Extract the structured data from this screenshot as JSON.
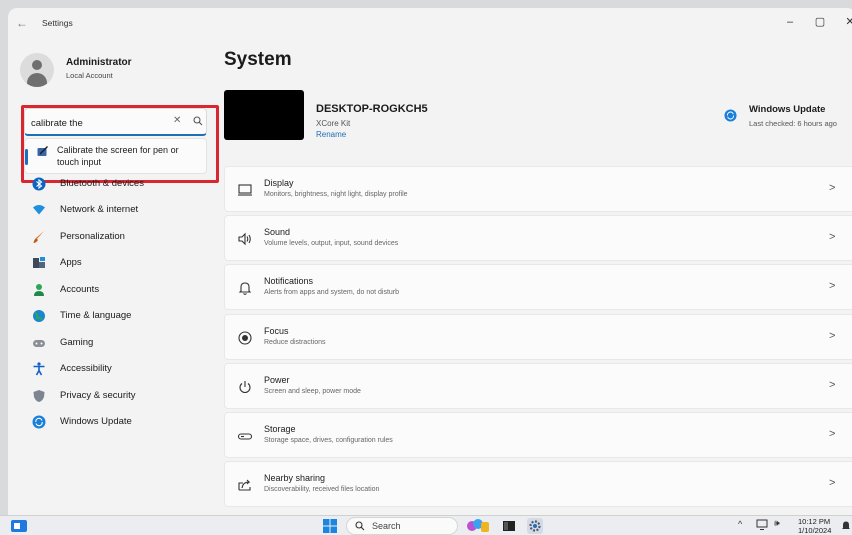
{
  "window": {
    "title": "Settings",
    "back_icon": "back-arrow-icon",
    "controls": {
      "minimize": "–",
      "maximize": "▢",
      "close": "✕"
    }
  },
  "user": {
    "name": "Administrator",
    "account_type": "Local Account"
  },
  "search": {
    "value": "calibrate the",
    "clear_icon": "✕",
    "suggestion": "Calibrate the screen for pen or touch input"
  },
  "sidebar": {
    "items": [
      {
        "label": "Bluetooth & devices",
        "icon": "bluetooth-icon",
        "color": "#0a65c2"
      },
      {
        "label": "Network & internet",
        "icon": "wifi-icon",
        "color": "#1f8fe0"
      },
      {
        "label": "Personalization",
        "icon": "brush-icon",
        "color": "#e07a22"
      },
      {
        "label": "Apps",
        "icon": "apps-icon",
        "color": "#3d4a5c"
      },
      {
        "label": "Accounts",
        "icon": "person-icon",
        "color": "#2aa75a"
      },
      {
        "label": "Time & language",
        "icon": "globe-clock-icon",
        "color": "#1a86d0"
      },
      {
        "label": "Gaming",
        "icon": "gamepad-icon",
        "color": "#8a8f96"
      },
      {
        "label": "Accessibility",
        "icon": "accessibility-icon",
        "color": "#1160c9"
      },
      {
        "label": "Privacy & security",
        "icon": "shield-icon",
        "color": "#7d8591"
      },
      {
        "label": "Windows Update",
        "icon": "update-icon",
        "color": "#1a7fd8"
      }
    ]
  },
  "main": {
    "title": "System",
    "device": {
      "name": "DESKTOP-ROGKCH5",
      "model": "XCore Kit",
      "rename": "Rename"
    },
    "windows_update": {
      "title": "Windows Update",
      "status": "Last checked: 6 hours ago"
    },
    "cards": [
      {
        "title": "Display",
        "subtitle": "Monitors, brightness, night light, display profile",
        "icon": "monitor-icon"
      },
      {
        "title": "Sound",
        "subtitle": "Volume levels, output, input, sound devices",
        "icon": "speaker-icon"
      },
      {
        "title": "Notifications",
        "subtitle": "Alerts from apps and system, do not disturb",
        "icon": "bell-icon"
      },
      {
        "title": "Focus",
        "subtitle": "Reduce distractions",
        "icon": "focus-icon"
      },
      {
        "title": "Power",
        "subtitle": "Screen and sleep, power mode",
        "icon": "power-icon"
      },
      {
        "title": "Storage",
        "subtitle": "Storage space, drives, configuration rules",
        "icon": "storage-drive-icon"
      },
      {
        "title": "Nearby sharing",
        "subtitle": "Discoverability, received files location",
        "icon": "share-icon"
      }
    ],
    "chevron": ">"
  },
  "taskbar": {
    "search_label": "Search",
    "tray_chevron": "^",
    "volume": "🕪",
    "time": "10:12 PM",
    "date": "1/10/2024"
  },
  "colors": {
    "accent": "#1f6fb8",
    "highlight_box": "#d92731"
  }
}
